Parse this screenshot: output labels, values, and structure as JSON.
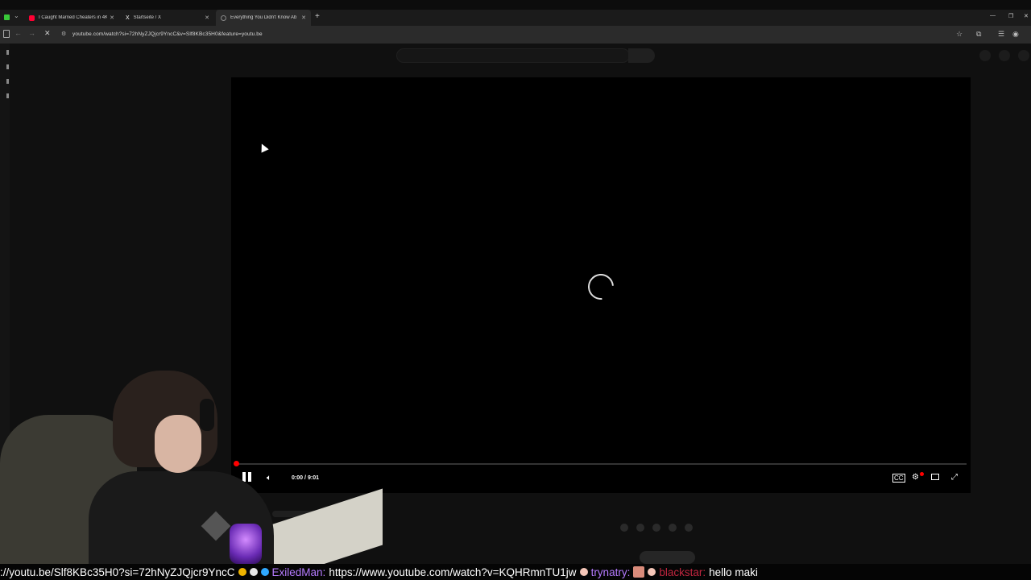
{
  "browser": {
    "tabs": [
      {
        "label": "I Caught Married Cheaters in 4K",
        "icon": "youtube-icon",
        "icon_color": "#ff0033"
      },
      {
        "label": "Startseite / X",
        "icon": "x-icon",
        "icon_color": "#ffffff"
      },
      {
        "label": "Everything You Didn't Know Ab",
        "icon": "loading-icon",
        "icon_color": "#888888"
      }
    ],
    "new_tab": "+",
    "url": "youtube.com/watch?si=72hNyZJQjcr9YncC&v=Slf8KBc35H0&feature=youtu.be",
    "window_controls": [
      "—",
      "❐",
      "✕"
    ]
  },
  "player": {
    "time_current": "0:00",
    "time_separator": "/",
    "time_total": "9:01",
    "progress": 0.0,
    "state": "loading"
  },
  "chat": [
    {
      "user": "",
      "text": "://youtu.be/Slf8KBc35H0?si=72hNyZJQjcr9YncC",
      "color": "#ffffff"
    },
    {
      "user": "ExiledMan:",
      "text": "https://www.youtube.com/watch?v=KQHRmnTU1jw",
      "color": "#b57bff"
    },
    {
      "user": "trynatry:",
      "text": "",
      "color": "#b57bff"
    },
    {
      "user": "blackstar:",
      "text": "hello maki",
      "color": "#c0263f"
    }
  ],
  "colors": {
    "accent_red": "#ff0000",
    "background": "#0f0f0f"
  }
}
